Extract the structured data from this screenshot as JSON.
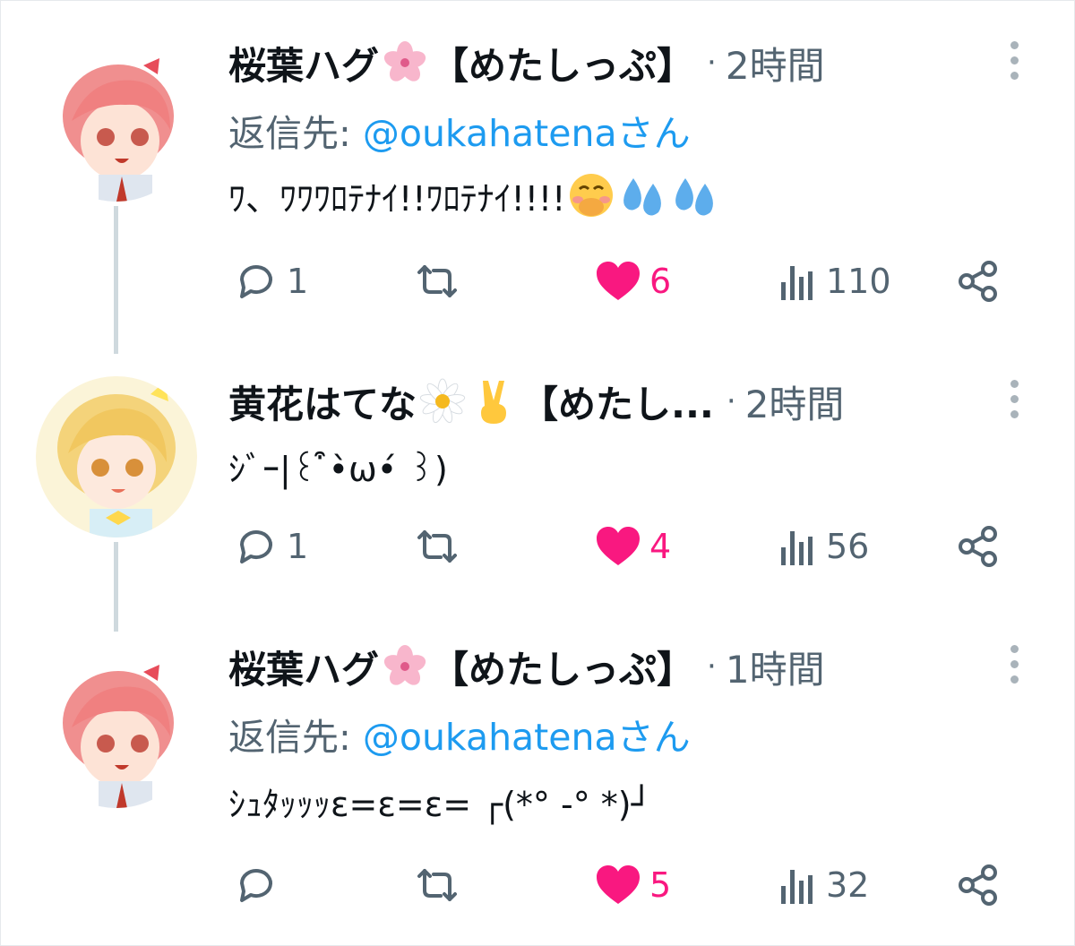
{
  "tweets": [
    {
      "author": "桜葉ハグ",
      "suffix": "【めたしっぷ】",
      "dot": "·",
      "time": "2時間",
      "reply_prefix": "返信先: ",
      "reply_handle": "@oukahatenaさん",
      "text": "ﾜ、ﾜﾜﾜﾛﾃﾅｲ!!ﾜﾛﾃﾅｲ!!!!",
      "icons": [
        "cherry-blossom-emoji",
        "hand-over-mouth-emoji",
        "sweat-droplets-emoji"
      ],
      "replies": "1",
      "retweets": "",
      "likes": "6",
      "views": "110"
    },
    {
      "author": "黄花はてな",
      "suffix": "【めたし...",
      "dot": "·",
      "time": "2時間",
      "text": "ｼﾞｰ|꒰ ͒•̀ω•́ ꒱)",
      "icons": [
        "daisy-emoji",
        "victory-hand-emoji"
      ],
      "replies": "1",
      "retweets": "",
      "likes": "4",
      "views": "56"
    },
    {
      "author": "桜葉ハグ",
      "suffix": "【めたしっぷ】",
      "dot": "·",
      "time": "1時間",
      "reply_prefix": "返信先: ",
      "reply_handle": "@oukahatenaさん",
      "text": "ｼｭﾀｯｯｯε=ε=ε= ┌(*° -° *)┘",
      "icons": [
        "cherry-blossom-emoji"
      ],
      "replies": "",
      "retweets": "",
      "likes": "5",
      "views": "32"
    }
  ],
  "colors": {
    "text": "#0f1419",
    "secondary": "#536471",
    "link": "#1d9bf0",
    "like": "#f91880",
    "thread_line": "#cfd9de"
  }
}
